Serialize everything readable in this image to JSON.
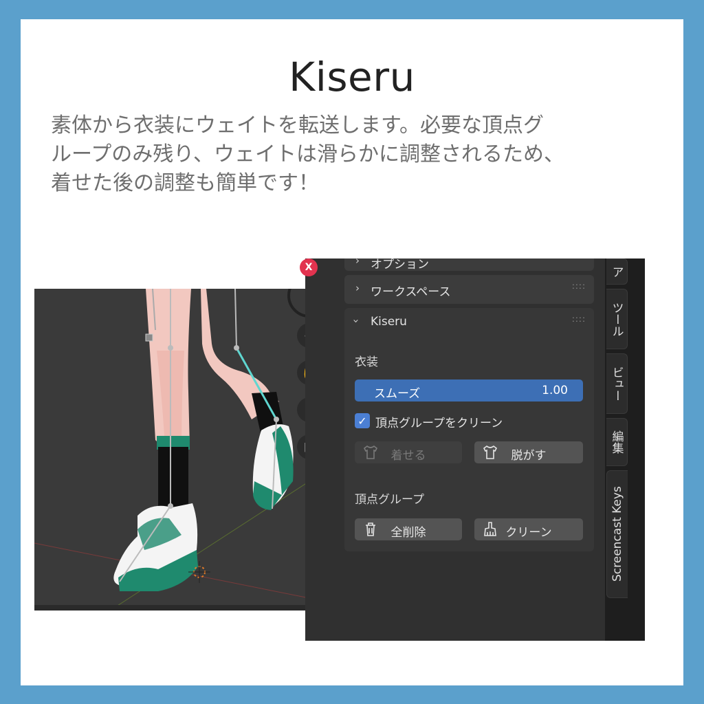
{
  "header": {
    "title": "Kiseru",
    "description_lines": [
      "素体から衣装にウェイトを転送します。必要な頂点グ",
      "ループのみ残り、ウェイトは滑らかに調整されるため、",
      "着せた後の調整も簡単です！"
    ]
  },
  "panel": {
    "close_label": "X",
    "sections": {
      "options_label": "オプション",
      "workspace_label": "ワークスペース",
      "kiseru_label": "Kiseru"
    },
    "costume": {
      "heading": "衣装",
      "smooth_label": "スムーズ",
      "smooth_value": "1.00",
      "clean_checkbox_label": "頂点グループをクリーン",
      "clean_checked": true,
      "dress_button": "着せる",
      "undress_button": "脱がす"
    },
    "vertex_groups": {
      "heading": "頂点グループ",
      "delete_all_button": "全削除",
      "clean_button": "クリーン"
    }
  },
  "tabs": [
    "ア",
    "ツール",
    "ビュー",
    "編集",
    "Screencast Keys"
  ],
  "colors": {
    "background": "#5ba0cc",
    "accent": "#3d6fb5",
    "panel": "#303030",
    "close": "#e2334f"
  }
}
